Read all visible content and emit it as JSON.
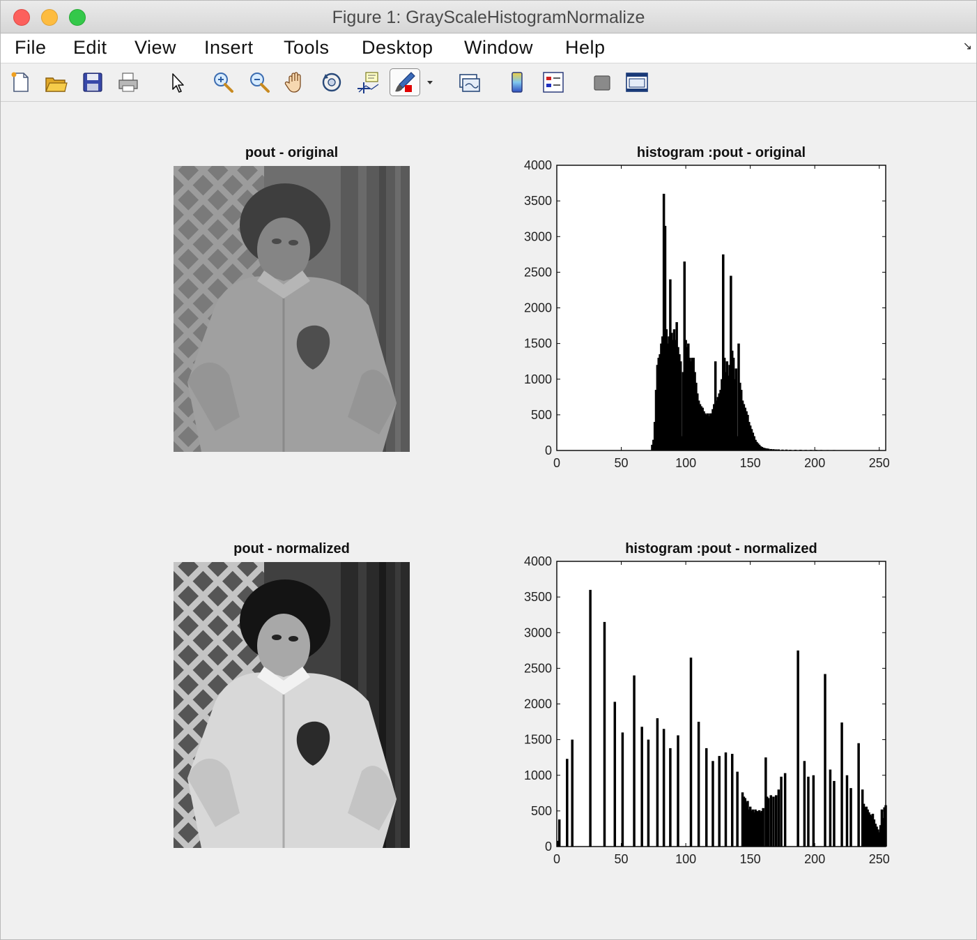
{
  "window": {
    "title": "Figure 1: GrayScaleHistogramNormalize"
  },
  "menu": [
    "File",
    "Edit",
    "View",
    "Insert",
    "Tools",
    "Desktop",
    "Window",
    "Help"
  ],
  "toolbar": {
    "icons": [
      "new-figure-icon",
      "open-file-icon",
      "save-icon",
      "print-icon",
      "edit-plot-arrow-icon",
      "zoom-in-icon",
      "zoom-out-icon",
      "pan-hand-icon",
      "rotate-3d-icon",
      "data-cursor-icon",
      "brush-icon",
      "brush-dropdown-icon",
      "link-plot-icon",
      "colorbar-icon",
      "legend-icon",
      "hide-plot-tools-icon",
      "show-plot-tools-icon"
    ]
  },
  "panels": {
    "img1_title": "pout - original",
    "img2_title": "pout - normalized",
    "hist1_title": "histogram :pout - original",
    "hist2_title": "histogram :pout - normalized"
  },
  "chart_data": [
    {
      "type": "bar",
      "title": "histogram :pout - original",
      "xlim": [
        0,
        255
      ],
      "ylim": [
        0,
        4000
      ],
      "xticks": [
        0,
        50,
        100,
        150,
        200,
        250
      ],
      "yticks": [
        0,
        500,
        1000,
        1500,
        2000,
        2500,
        3000,
        3500,
        4000
      ],
      "bins": [
        [
          74,
          80
        ],
        [
          75,
          150
        ],
        [
          76,
          400
        ],
        [
          77,
          850
        ],
        [
          78,
          1200
        ],
        [
          79,
          1300
        ],
        [
          80,
          1350
        ],
        [
          81,
          1500
        ],
        [
          82,
          1600
        ],
        [
          83,
          3600
        ],
        [
          84,
          3150
        ],
        [
          85,
          1700
        ],
        [
          86,
          1500
        ],
        [
          87,
          1600
        ],
        [
          88,
          2400
        ],
        [
          89,
          1650
        ],
        [
          90,
          1550
        ],
        [
          91,
          1700
        ],
        [
          92,
          1550
        ],
        [
          93,
          1800
        ],
        [
          94,
          1450
        ],
        [
          95,
          1350
        ],
        [
          96,
          1250
        ],
        [
          97,
          200
        ],
        [
          98,
          1100
        ],
        [
          99,
          2650
        ],
        [
          100,
          1550
        ],
        [
          101,
          1450
        ],
        [
          102,
          1500
        ],
        [
          103,
          1300
        ],
        [
          104,
          1250
        ],
        [
          105,
          1300
        ],
        [
          106,
          1300
        ],
        [
          107,
          1100
        ],
        [
          108,
          950
        ],
        [
          109,
          800
        ],
        [
          110,
          700
        ],
        [
          111,
          650
        ],
        [
          112,
          620
        ],
        [
          113,
          600
        ],
        [
          114,
          550
        ],
        [
          115,
          520
        ],
        [
          116,
          500
        ],
        [
          117,
          520
        ],
        [
          118,
          480
        ],
        [
          119,
          520
        ],
        [
          120,
          520
        ],
        [
          121,
          580
        ],
        [
          122,
          650
        ],
        [
          123,
          1250
        ],
        [
          124,
          700
        ],
        [
          125,
          750
        ],
        [
          126,
          800
        ],
        [
          127,
          850
        ],
        [
          128,
          1000
        ],
        [
          129,
          2750
        ],
        [
          130,
          1300
        ],
        [
          131,
          1100
        ],
        [
          132,
          1250
        ],
        [
          133,
          1050
        ],
        [
          134,
          1200
        ],
        [
          135,
          2450
        ],
        [
          136,
          1400
        ],
        [
          137,
          1300
        ],
        [
          138,
          1000
        ],
        [
          139,
          1150
        ],
        [
          140,
          200
        ],
        [
          141,
          1500
        ],
        [
          142,
          950
        ],
        [
          143,
          850
        ],
        [
          144,
          700
        ],
        [
          145,
          650
        ],
        [
          146,
          600
        ],
        [
          147,
          550
        ],
        [
          148,
          500
        ],
        [
          149,
          400
        ],
        [
          150,
          350
        ],
        [
          151,
          300
        ],
        [
          152,
          250
        ],
        [
          153,
          200
        ],
        [
          154,
          150
        ],
        [
          155,
          120
        ],
        [
          156,
          100
        ],
        [
          157,
          80
        ],
        [
          158,
          60
        ],
        [
          159,
          50
        ],
        [
          160,
          40
        ],
        [
          161,
          35
        ],
        [
          162,
          30
        ],
        [
          163,
          28
        ],
        [
          164,
          25
        ],
        [
          166,
          20
        ],
        [
          168,
          18
        ],
        [
          170,
          15
        ],
        [
          172,
          15
        ],
        [
          175,
          12
        ],
        [
          178,
          12
        ],
        [
          181,
          10
        ],
        [
          185,
          10
        ],
        [
          189,
          10
        ],
        [
          193,
          8
        ],
        [
          197,
          8
        ],
        [
          201,
          8
        ],
        [
          205,
          7
        ],
        [
          210,
          6
        ],
        [
          215,
          6
        ],
        [
          220,
          5
        ],
        [
          224,
          5
        ]
      ]
    },
    {
      "type": "bar",
      "title": "histogram :pout - normalized",
      "xlim": [
        0,
        255
      ],
      "ylim": [
        0,
        4000
      ],
      "xticks": [
        0,
        50,
        100,
        150,
        200,
        250
      ],
      "yticks": [
        0,
        500,
        1000,
        1500,
        2000,
        2500,
        3000,
        3500,
        4000
      ],
      "bins": [
        [
          1,
          80
        ],
        [
          2,
          380
        ],
        [
          8,
          1230
        ],
        [
          12,
          1500
        ],
        [
          26,
          3600
        ],
        [
          37,
          3150
        ],
        [
          45,
          2030
        ],
        [
          51,
          1600
        ],
        [
          60,
          2400
        ],
        [
          66,
          1680
        ],
        [
          71,
          1500
        ],
        [
          78,
          1800
        ],
        [
          83,
          1650
        ],
        [
          88,
          1380
        ],
        [
          94,
          1560
        ],
        [
          104,
          2650
        ],
        [
          110,
          1750
        ],
        [
          116,
          1380
        ],
        [
          121,
          1200
        ],
        [
          126,
          1270
        ],
        [
          131,
          1320
        ],
        [
          136,
          1300
        ],
        [
          140,
          1050
        ],
        [
          144,
          760
        ],
        [
          145,
          700
        ],
        [
          146,
          680
        ],
        [
          147,
          620
        ],
        [
          148,
          640
        ],
        [
          149,
          520
        ],
        [
          150,
          560
        ],
        [
          151,
          500
        ],
        [
          152,
          520
        ],
        [
          153,
          480
        ],
        [
          154,
          520
        ],
        [
          155,
          500
        ],
        [
          156,
          490
        ],
        [
          157,
          510
        ],
        [
          158,
          480
        ],
        [
          159,
          500
        ],
        [
          160,
          540
        ],
        [
          162,
          1250
        ],
        [
          163,
          700
        ],
        [
          164,
          680
        ],
        [
          166,
          720
        ],
        [
          168,
          700
        ],
        [
          170,
          720
        ],
        [
          172,
          800
        ],
        [
          174,
          980
        ],
        [
          177,
          1030
        ],
        [
          187,
          2750
        ],
        [
          192,
          1200
        ],
        [
          195,
          980
        ],
        [
          199,
          1000
        ],
        [
          208,
          2420
        ],
        [
          212,
          1080
        ],
        [
          215,
          920
        ],
        [
          221,
          1740
        ],
        [
          225,
          1000
        ],
        [
          228,
          820
        ],
        [
          234,
          1450
        ],
        [
          237,
          800
        ],
        [
          238,
          600
        ],
        [
          239,
          550
        ],
        [
          240,
          560
        ],
        [
          241,
          520
        ],
        [
          242,
          480
        ],
        [
          243,
          450
        ],
        [
          244,
          430
        ],
        [
          245,
          460
        ],
        [
          246,
          380
        ],
        [
          247,
          320
        ],
        [
          248,
          280
        ],
        [
          249,
          240
        ],
        [
          250,
          200
        ],
        [
          251,
          300
        ],
        [
          252,
          520
        ],
        [
          253,
          400
        ],
        [
          254,
          550
        ],
        [
          255,
          580
        ]
      ]
    }
  ]
}
